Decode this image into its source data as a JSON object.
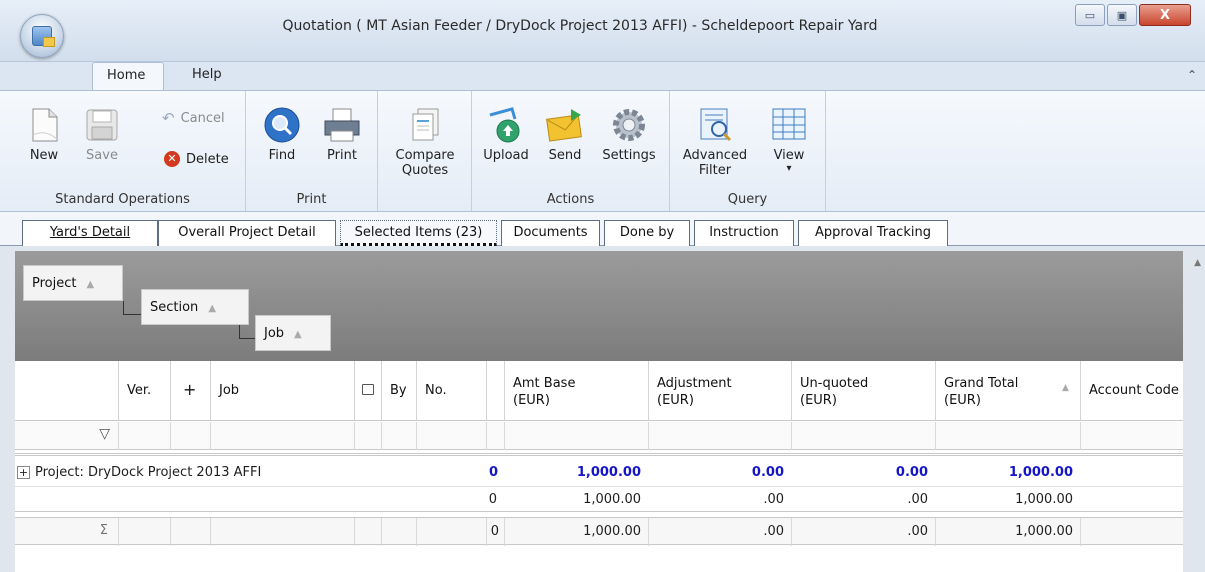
{
  "window": {
    "title": "Quotation ( MT Asian Feeder / DryDock Project 2013 AFFI) - Scheldepoort Repair Yard",
    "controls": {
      "minimize": "▭",
      "restore": "▣",
      "close": "X"
    }
  },
  "ribbon_tabs": [
    "Home",
    "Help"
  ],
  "ribbon": {
    "standard_operations": {
      "label": "Standard Operations",
      "new": "New",
      "save": "Save",
      "cancel": "Cancel",
      "delete": "Delete"
    },
    "print_group": {
      "label": "Print",
      "find": "Find",
      "print": "Print"
    },
    "compare": {
      "line1": "Compare",
      "line2": "Quotes"
    },
    "actions": {
      "label": "Actions",
      "upload": "Upload",
      "send": "Send",
      "settings": "Settings"
    },
    "query": {
      "label": "Query",
      "advanced_line1": "Advanced",
      "advanced_line2": "Filter",
      "view": "View",
      "view_arrow": "▾"
    }
  },
  "doc_tabs": [
    "Yard's Detail",
    "Overall Project Detail",
    "Selected Items (23)",
    "Documents",
    "Done by",
    "Instruction",
    "Approval Tracking"
  ],
  "group_panel": {
    "project": "Project",
    "section": "Section",
    "job": "Job",
    "sort_arrow": "▲"
  },
  "columns": {
    "ver": "Ver.",
    "plus": "+",
    "job": "Job",
    "by": "By",
    "no": "No.",
    "amt_base_1": "Amt Base",
    "amt_base_2": "(EUR)",
    "adjustment_1": "Adjustment",
    "adjustment_2": "(EUR)",
    "unquoted_1": "Un-quoted",
    "unquoted_2": "(EUR)",
    "grand_total_1": "Grand Total",
    "grand_total_2": "(EUR)",
    "account_code": "Account Code"
  },
  "rows": {
    "group": {
      "expander": "+",
      "label": "Project:  DryDock Project 2013 AFFI",
      "no": "0",
      "amt_base": "1,000.00",
      "adjustment": "0.00",
      "unquoted": "0.00",
      "grand_total": "1,000.00"
    },
    "subtotal": {
      "no": "0",
      "amt_base": "1,000.00",
      "adjustment": ".00",
      "unquoted": ".00",
      "grand_total": "1,000.00"
    },
    "total": {
      "sigma": "Σ",
      "no": "0",
      "amt_base": "1,000.00",
      "adjustment": ".00",
      "unquoted": ".00",
      "grand_total": "1,000.00"
    }
  },
  "icons": {
    "filter": "▽",
    "collapse": "⌃",
    "scroll_up": "▲"
  },
  "colors": {
    "total_blue": "#1515c8",
    "group_panel_gray": "#8b8b8b"
  }
}
